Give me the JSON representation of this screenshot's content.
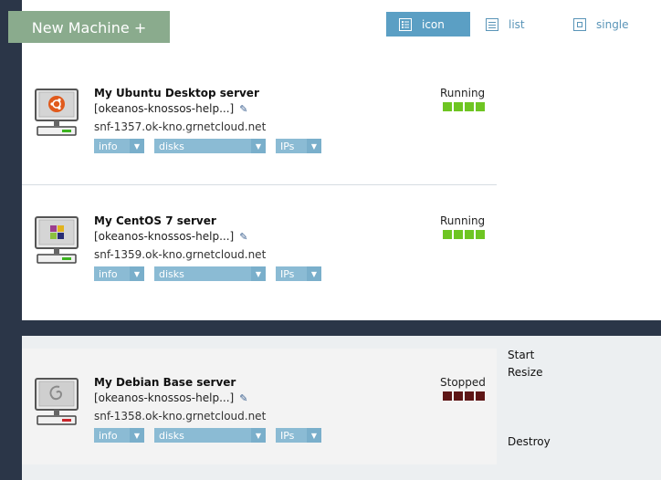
{
  "toolbar": {
    "new_machine_label": "New Machine +",
    "views": [
      {
        "label": "icon",
        "active": true
      },
      {
        "label": "list",
        "active": false
      },
      {
        "label": "single",
        "active": false
      }
    ]
  },
  "colors": {
    "rail": "#2b3648",
    "accent": "#5b9fc4",
    "new_button": "#8aab8d",
    "running_light": "#6ec522",
    "stopped_light": "#5e1616"
  },
  "machines": [
    {
      "name": "My Ubuntu Desktop server",
      "description": "[okeanos-knossos-help...]",
      "hostname": "snf-1357.ok-kno.grnetcloud.net",
      "os_icon": "ubuntu-logo-icon",
      "status": "Running",
      "menus": [
        "info",
        "disks",
        "IPs"
      ]
    },
    {
      "name": "My CentOS 7 server",
      "description": "[okeanos-knossos-help...]",
      "hostname": "snf-1359.ok-kno.grnetcloud.net",
      "os_icon": "centos-logo-icon",
      "status": "Running",
      "menus": [
        "info",
        "disks",
        "IPs"
      ]
    },
    {
      "name": "My Debian Base server",
      "description": "[okeanos-knossos-help...]",
      "hostname": "snf-1358.ok-kno.grnetcloud.net",
      "os_icon": "debian-logo-icon",
      "status": "Stopped",
      "menus": [
        "info",
        "disks",
        "IPs"
      ]
    }
  ],
  "actions": [
    "Start",
    "Resize",
    "Destroy"
  ]
}
